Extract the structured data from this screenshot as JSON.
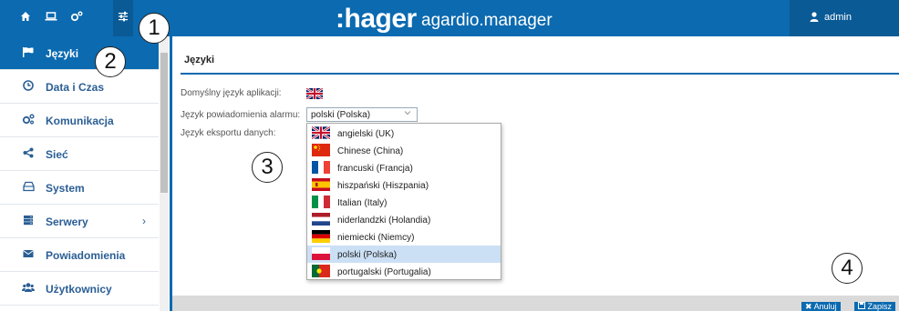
{
  "topbar": {
    "icons": [
      "home-icon",
      "laptop-icon",
      "cogs-icon",
      "sliders-icon"
    ],
    "brand": ":hager",
    "product": "agardio.manager",
    "user": "admin",
    "user_icon": "user-icon"
  },
  "callouts": [
    "1",
    "2",
    "3",
    "4"
  ],
  "sidebar": {
    "items": [
      {
        "label": "Języki",
        "icon": "flag-icon"
      },
      {
        "label": "Data i Czas",
        "icon": "clock-icon"
      },
      {
        "label": "Komunikacja",
        "icon": "cogs-icon"
      },
      {
        "label": "Sieć",
        "icon": "share-icon"
      },
      {
        "label": "System",
        "icon": "hdd-icon"
      },
      {
        "label": "Serwery",
        "icon": "server-icon",
        "chevron": "›"
      },
      {
        "label": "Powiadomienia",
        "icon": "envelope-icon"
      },
      {
        "label": "Użytkownicy",
        "icon": "users-icon"
      }
    ]
  },
  "main": {
    "title": "Języki",
    "fields": {
      "default_lang": "Domyślny język aplikacji:",
      "alarm_lang": "Język powiadomienia alarmu:",
      "export_lang": "Język eksportu danych:"
    },
    "alarm_select_value": "polski (Polska)",
    "dropdown_options": [
      "angielski (UK)",
      "Chinese (China)",
      "francuski (Francja)",
      "hiszpański (Hiszpania)",
      "Italian (Italy)",
      "niderlandzki (Holandia)",
      "niemiecki (Niemcy)",
      "polski (Polska)",
      "portugalski (Portugalia)"
    ],
    "selected_option": "polski (Polska)"
  },
  "footer": {
    "cancel_label": "Anuluj",
    "save_label": "Zapisz"
  },
  "colors": {
    "primary": "#0b6ab0",
    "selected_row": "#cce0f5"
  }
}
